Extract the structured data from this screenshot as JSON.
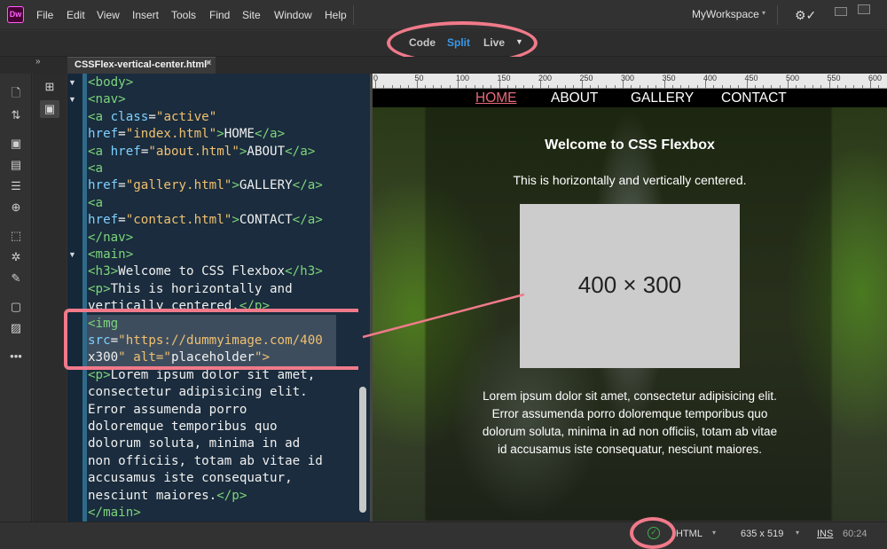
{
  "app": {
    "logo": "Dw"
  },
  "menu": [
    "File",
    "Edit",
    "View",
    "Insert",
    "Tools",
    "Find",
    "Site",
    "Window",
    "Help"
  ],
  "workspace": {
    "label": "MyWorkspace",
    "chevron": "▾"
  },
  "view_toggle": {
    "code": "Code",
    "split": "Split",
    "live": "Live",
    "active": "Split",
    "accent": "#3a99e8"
  },
  "collapse_glyph": "»",
  "document_tab": {
    "label": "CSSFlex-vertical-center.html*",
    "close": "✕"
  },
  "left_tools": [
    "file-icon",
    "sort-icon",
    "code-nav-icon",
    "inspect-icon",
    "indent-icon",
    "target-icon",
    "select-icon",
    "wand-icon",
    "brush-icon",
    "comment-icon",
    "code-check-icon",
    "more-icon"
  ],
  "panel_icons": [
    "dom-tree-icon",
    "live-code-icon"
  ],
  "ruler": {
    "ticks": [
      "0",
      "50",
      "100",
      "150",
      "200",
      "250",
      "300",
      "350",
      "400",
      "450",
      "500",
      "550",
      "600"
    ]
  },
  "code_lines": [
    "<body>",
    "<nav>",
    "<a class=\"active\"",
    "href=\"index.html\">HOME</a>",
    "<a href=\"about.html\">ABOUT</a>",
    "<a",
    "href=\"gallery.html\">GALLERY</a>",
    "<a",
    "href=\"contact.html\">CONTACT</a>",
    "</nav>",
    "<main>",
    "<h3>Welcome to CSS Flexbox</h3>",
    "<p>This is horizontally and",
    "vertically centered.</p>",
    "<img",
    "src=\"https://dummyimage.com/400",
    "x300\" alt=\"placeholder\">",
    "<p>Lorem ipsum dolor sit amet,",
    "consectetur adipisicing elit.",
    "Error assumenda porro",
    "doloremque temporibus quo",
    "dolorum soluta, minima in ad",
    "non officiis, totam ab vitae id",
    "accusamus iste consequatur,",
    "nesciunt maiores.</p>",
    "</main>"
  ],
  "live": {
    "nav": [
      "HOME",
      "ABOUT",
      "GALLERY",
      "CONTACT"
    ],
    "heading": "Welcome to CSS Flexbox",
    "subtitle": "This is horizontally and vertically centered.",
    "placeholder": "400 × 300",
    "lorem": "Lorem ipsum dolor sit amet, consectetur adipisicing elit. Error assumenda porro doloremque temporibus quo dolorum soluta, minima in ad non officiis, totam ab vitae id accusamus iste consequatur, nesciunt maiores."
  },
  "status": {
    "doc_type": "HTML",
    "size": "635 x 519",
    "ins": "INS",
    "cursor": "60:24",
    "ok": "✓"
  },
  "colors": {
    "highlight": "#f07a8a",
    "nav_active": "#e76a7a"
  }
}
